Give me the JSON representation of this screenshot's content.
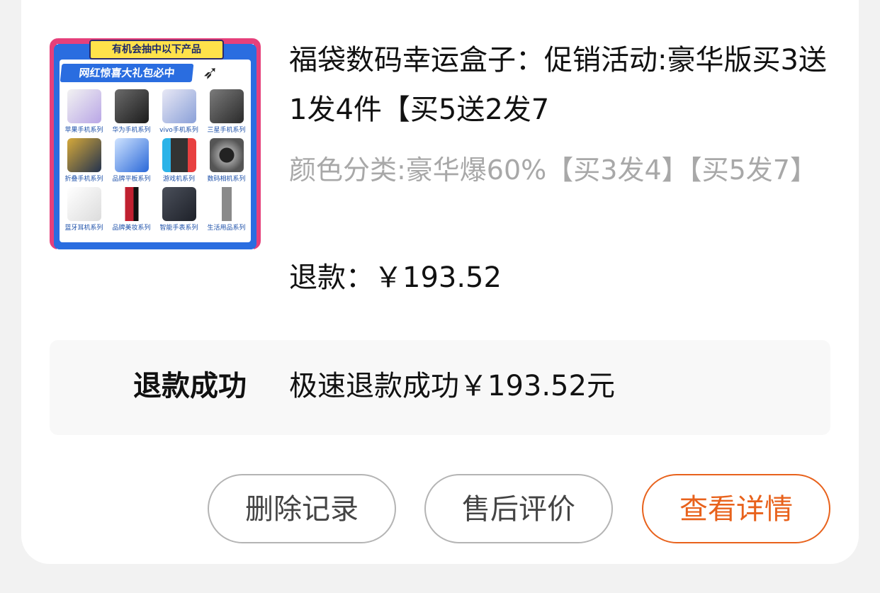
{
  "product": {
    "thumbnail": {
      "top_banner": "有机会抽中以下产品",
      "main_banner": "网红惊喜大礼包必中",
      "categories": [
        "苹果手机系列",
        "华为手机系列",
        "vivo手机系列",
        "三星手机系列",
        "折叠手机系列",
        "品牌平板系列",
        "游戏机系列",
        "数码相机系列",
        "蓝牙耳机系列",
        "品牌美妆系列",
        "智能手表系列",
        "生活用品系列"
      ]
    },
    "title": "福袋数码幸运盒子：促销活动:豪华版买3送1发4件【买5送2发7",
    "sku": "颜色分类:豪华爆60%【买3发4】【买5发7】",
    "refund": "退款：￥193.52"
  },
  "status": {
    "label": "退款成功",
    "description": "极速退款成功￥193.52元"
  },
  "actions": {
    "delete": "删除记录",
    "review": "售后评价",
    "details": "查看详情"
  },
  "colors": {
    "accent": "#e8621c",
    "text": "#111111",
    "muted": "#a8a8a8",
    "background": "#f2f2f2"
  }
}
